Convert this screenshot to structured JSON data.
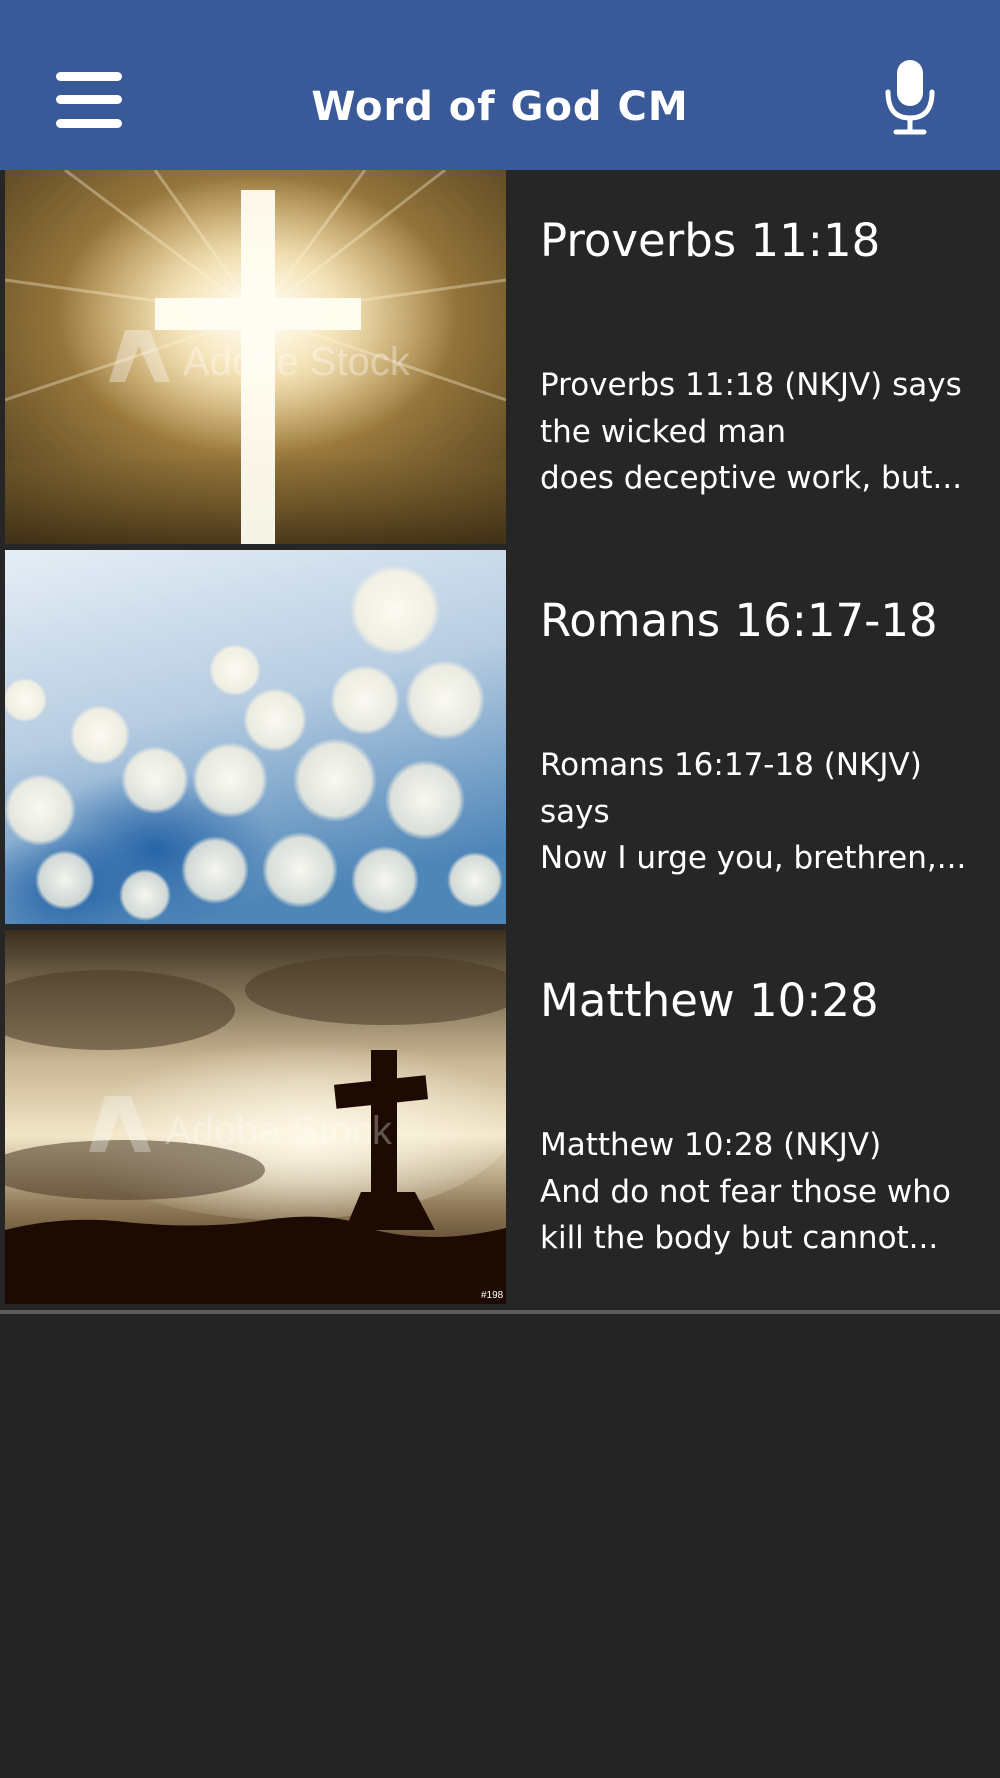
{
  "app_bar": {
    "title": "Word of God CM",
    "menu_icon": "hamburger-menu-icon",
    "mic_icon": "microphone-icon",
    "background_color": "#3a5998"
  },
  "list": {
    "items": [
      {
        "title": "Proverbs 11:18",
        "text": "Proverbs 11:18 (NKJV) says\nthe wicked man\ndoes deceptive work, but...",
        "image": "glowing-cross-image",
        "watermark": "Adobe Stock"
      },
      {
        "title": "Romans 16:17-18",
        "text": "Romans 16:17-18 (NKJV)\nsays\nNow I urge you, brethren,...",
        "image": "blue-bokeh-image"
      },
      {
        "title": "Matthew 10:28",
        "text": "Matthew 10:28 (NKJV)\nAnd do not fear those who\nkill the body but cannot...",
        "image": "cross-silhouette-sky-image",
        "watermark": "Adobe Stock",
        "image_tag": "#198"
      }
    ]
  },
  "colors": {
    "background": "#242424",
    "row_background": "#262626",
    "divider": "#5d5d5d"
  }
}
